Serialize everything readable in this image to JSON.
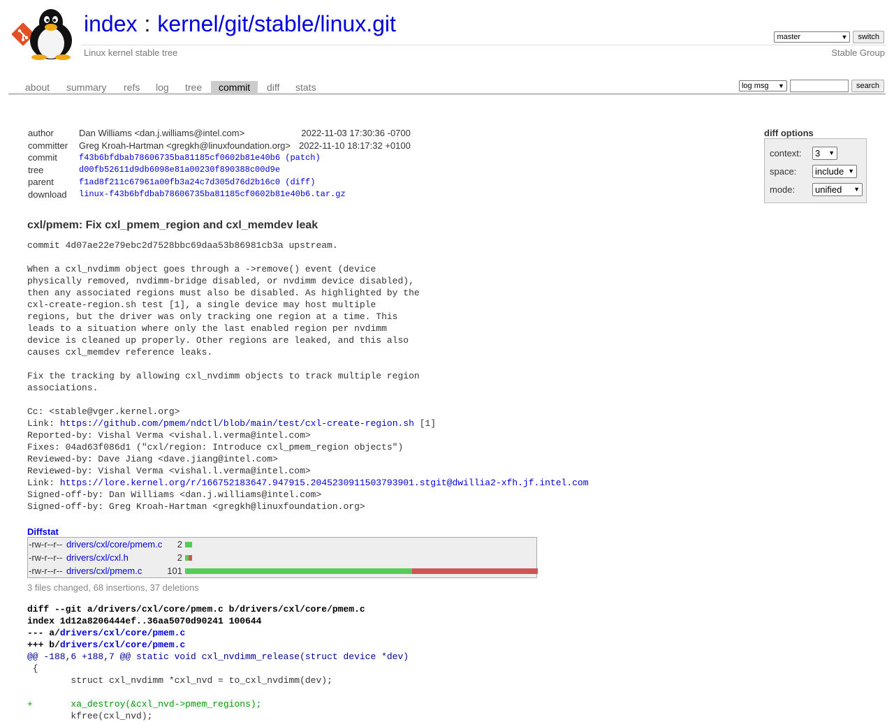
{
  "header": {
    "title_prefix": "index",
    "title_separator": ":",
    "repo_path": "kernel/git/stable/linux.git",
    "description": "Linux kernel stable tree",
    "owner": "Stable Group",
    "branch_selected": "master",
    "switch_label": "switch"
  },
  "tabs": [
    "about",
    "summary",
    "refs",
    "log",
    "tree",
    "commit",
    "diff",
    "stats"
  ],
  "active_tab": "commit",
  "search": {
    "scope_selected": "log msg",
    "query": "",
    "button_label": "search"
  },
  "commit_info": {
    "author_label": "author",
    "author": "Dan Williams <dan.j.williams@intel.com>",
    "author_date": "2022-11-03 17:30:36 -0700",
    "committer_label": "committer",
    "committer": "Greg Kroah-Hartman <gregkh@linuxfoundation.org>",
    "committer_date": "2022-11-10 18:17:32 +0100",
    "commit_label": "commit",
    "commit_hash": "f43b6bfdbab78606735ba81185cf0602b81e40b6",
    "commit_extra": "patch",
    "tree_label": "tree",
    "tree_hash": "d00fb52611d9db6098e81a00230f890388c00d9e",
    "parent_label": "parent",
    "parent_hash": "f1ad8f211c67961a00fb3a24c7d305d76d2b16c0",
    "parent_extra": "diff",
    "download_label": "download",
    "download_file": "linux-f43b6bfdbab78606735ba81185cf0602b81e40b6.tar.gz"
  },
  "diff_options": {
    "title": "diff options",
    "context_label": "context:",
    "context_value": "3",
    "space_label": "space:",
    "space_value": "include",
    "mode_label": "mode:",
    "mode_value": "unified"
  },
  "subject": "cxl/pmem: Fix cxl_pmem_region and cxl_memdev leak",
  "message_lines": [
    "commit 4d07ae22e79ebc2d7528bbc69daa53b86981cb3a upstream.",
    "",
    "When a cxl_nvdimm object goes through a ->remove() event (device",
    "physically removed, nvdimm-bridge disabled, or nvdimm device disabled),",
    "then any associated regions must also be disabled. As highlighted by the",
    "cxl-create-region.sh test [1], a single device may host multiple",
    "regions, but the driver was only tracking one region at a time. This",
    "leads to a situation where only the last enabled region per nvdimm",
    "device is cleaned up properly. Other regions are leaked, and this also",
    "causes cxl_memdev reference leaks.",
    "",
    "Fix the tracking by allowing cxl_nvdimm objects to track multiple region",
    "associations.",
    "",
    "Cc: <stable@vger.kernel.org>",
    "Link: ",
    "Reported-by: Vishal Verma <vishal.l.verma@intel.com>",
    "Fixes: 04ad63f086d1 (\"cxl/region: Introduce cxl_pmem_region objects\")",
    "Reviewed-by: Dave Jiang <dave.jiang@intel.com>",
    "Reviewed-by: Vishal Verma <vishal.l.verma@intel.com>",
    "Link: ",
    "Signed-off-by: Dan Williams <dan.j.williams@intel.com>",
    "Signed-off-by: Greg Kroah-Hartman <gregkh@linuxfoundation.org>"
  ],
  "message_links": {
    "link1_url": "https://github.com/pmem/ndctl/blob/main/test/cxl-create-region.sh",
    "link1_suffix": " [1]",
    "link2_url": "https://lore.kernel.org/r/166752183647.947915.2045230911503793901.stgit@dwillia2-xfh.jf.intel.com"
  },
  "diffstat": {
    "title": "Diffstat",
    "files": [
      {
        "mode": "-rw-r--r--",
        "path": "drivers/cxl/core/pmem.c",
        "changes": "2",
        "add": 2,
        "del": 0
      },
      {
        "mode": "-rw-r--r--",
        "path": "drivers/cxl/cxl.h",
        "changes": "2",
        "add": 1,
        "del": 1
      },
      {
        "mode": "-rw-r--r--",
        "path": "drivers/cxl/pmem.c",
        "changes": "101",
        "add": 65,
        "del": 36
      }
    ],
    "summary": "3 files changed, 68 insertions, 37 deletions"
  },
  "diff": {
    "git_line": "diff --git a/drivers/cxl/core/pmem.c b/drivers/cxl/core/pmem.c",
    "index_line": "index 1d12a8206444ef..36aa5070d90241 100644",
    "minus_prefix": "--- a/",
    "plus_prefix": "+++ b/",
    "file": "drivers/cxl/core/pmem.c",
    "hunk": "@@ -188,6 +188,7 @@ static void cxl_nvdimm_release(struct device *dev)",
    "lines": [
      {
        "type": "ctx",
        "text": " {"
      },
      {
        "type": "ctx",
        "text": " \tstruct cxl_nvdimm *cxl_nvd = to_cxl_nvdimm(dev);"
      },
      {
        "type": "ctx",
        "text": " "
      },
      {
        "type": "add",
        "text": "+\txa_destroy(&cxl_nvd->pmem_regions);"
      },
      {
        "type": "ctx",
        "text": " \tkfree(cxl_nvd);"
      }
    ]
  },
  "colors": {
    "link": "#0000dd",
    "tab_active_bg": "#cccccc",
    "diffstat_add": "#55cc55",
    "diffstat_del": "#cc5555",
    "diff_add": "#009900",
    "diff_hunk": "#000099"
  }
}
